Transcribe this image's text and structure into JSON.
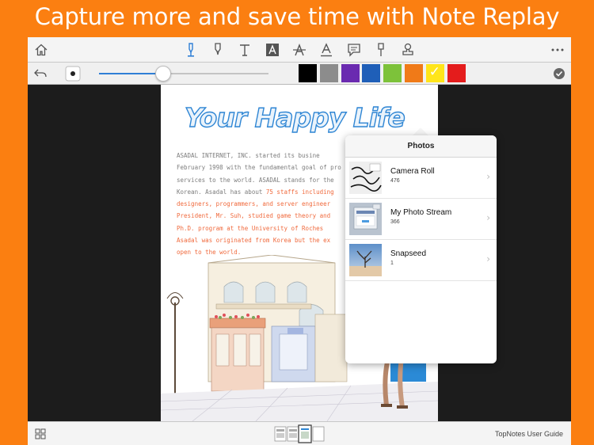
{
  "headline": "Capture more and save time with Note Replay",
  "colors": {
    "background": "#fb7f11",
    "accent": "#2f7fd6",
    "palette": [
      "#000000",
      "#8c8c8c",
      "#6a2ab0",
      "#1f5fb8",
      "#7dc23a",
      "#f07a18",
      "#ffe51a",
      "#e41c1c"
    ],
    "selected_swatch": "#ffe51a"
  },
  "toolbar": {
    "icons": [
      "home-icon",
      "pen-icon",
      "marker-icon",
      "text-icon",
      "text-box-icon",
      "strikethrough-icon",
      "underline-icon",
      "comment-icon",
      "pin-icon",
      "stamp-icon",
      "more-icon"
    ]
  },
  "subbar": {
    "icons": [
      "undo-icon",
      "dot-size-icon",
      "done-icon"
    ],
    "slider_value": 0.38
  },
  "document": {
    "title": "Your Happy Life",
    "lines": [
      {
        "normal": "ASADAL INTERNET, INC. started its busine",
        "highlight": ""
      },
      {
        "normal": "February 1998 with the fundamental goal of pro",
        "highlight": ""
      },
      {
        "normal": "services to the world. ASADAL stands for the",
        "highlight": ""
      },
      {
        "normal": " Korean. Asadal has about ",
        "highlight": "75 staffs including"
      },
      {
        "normal": "",
        "highlight": "designers, programmers, and server engineer"
      },
      {
        "normal": "",
        "highlight": "President, Mr. Suh, studied game theory and"
      },
      {
        "normal": "",
        "highlight": " Ph.D. program at the University of Roches"
      },
      {
        "normal": "",
        "highlight": "Asadal was originated from Korea but the ex"
      },
      {
        "normal": "",
        "highlight": "open to the world."
      }
    ]
  },
  "popover": {
    "title": "Photos",
    "albums": [
      {
        "name": "Camera Roll",
        "count": "476"
      },
      {
        "name": "My Photo Stream",
        "count": "366"
      },
      {
        "name": "Snapseed",
        "count": "1"
      }
    ]
  },
  "bottombar": {
    "guide_label": "TopNotes User Guide"
  }
}
